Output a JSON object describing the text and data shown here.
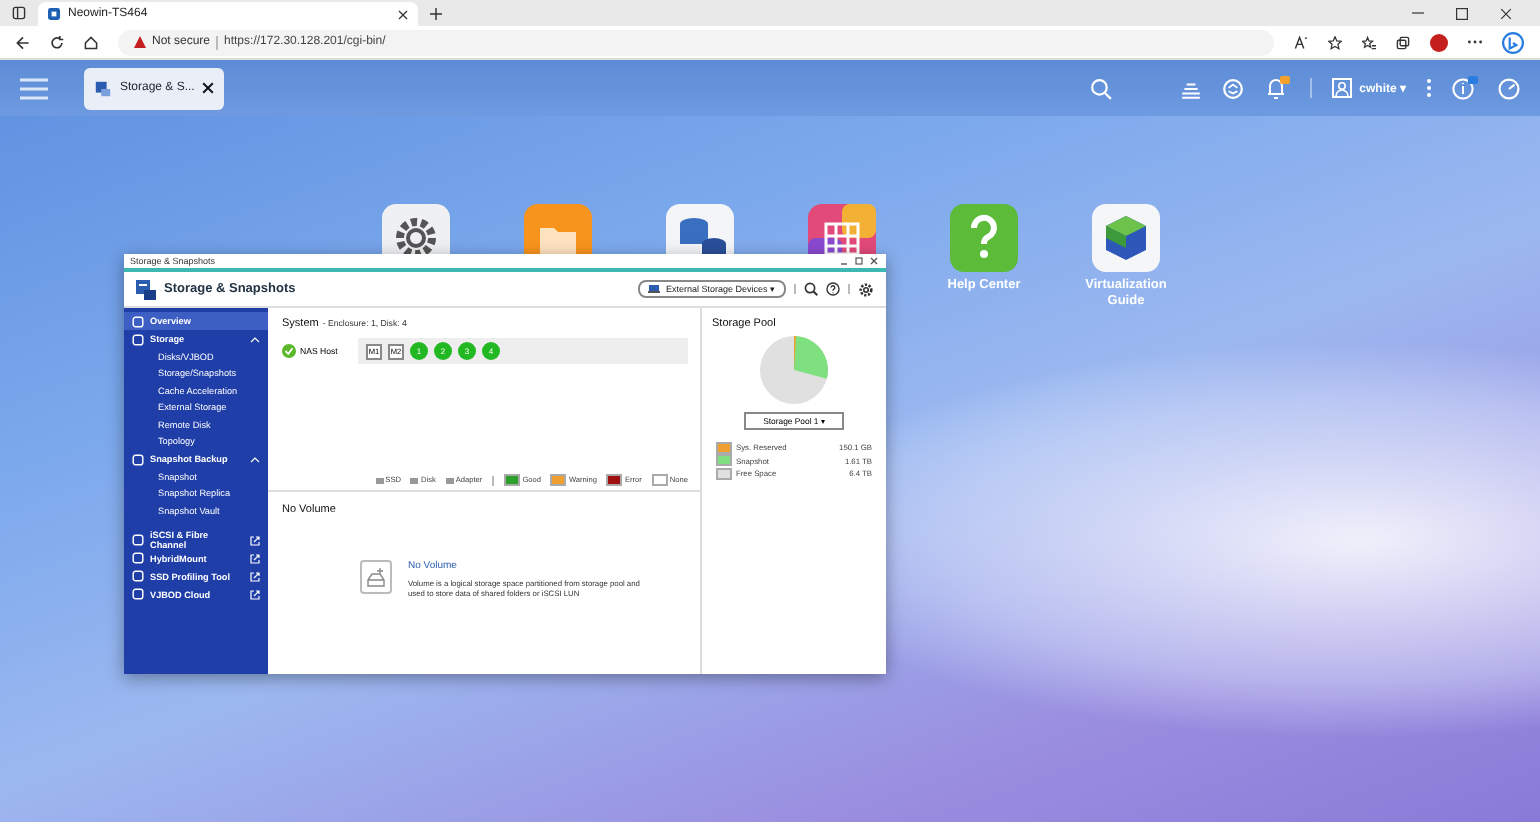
{
  "browser": {
    "tab_title": "Neowin-TS464",
    "security": "Not secure",
    "url": "https://172.30.128.201/cgi-bin/"
  },
  "taskbar": {
    "app_tab": "Storage & S...",
    "user": "cwhite ▾"
  },
  "desktop_icons": [
    {
      "kind": "settings"
    },
    {
      "kind": "folder"
    },
    {
      "kind": "storage"
    },
    {
      "kind": "apps"
    },
    {
      "kind": "help",
      "label": "Help Center"
    },
    {
      "kind": "virtualization",
      "label": "Virtualization Guide"
    }
  ],
  "window": {
    "title": "Storage & Snapshots",
    "header": "Storage & Snapshots",
    "device_menu": "External Storage Devices ▾",
    "sidebar": [
      {
        "kind": "item",
        "label": "Overview",
        "selected": true
      },
      {
        "kind": "group",
        "label": "Storage",
        "selected": false,
        "expanded": true,
        "children": [
          {
            "label": "Disks/VJBOD",
            "selected": false
          },
          {
            "label": "Storage/Snapshots",
            "selected": false
          },
          {
            "label": "Cache Acceleration",
            "selected": false
          },
          {
            "label": "External Storage",
            "selected": false
          },
          {
            "label": "Remote Disk",
            "selected": false
          },
          {
            "label": "Topology",
            "selected": false
          }
        ]
      },
      {
        "kind": "group",
        "label": "Snapshot Backup",
        "selected": false,
        "expanded": true,
        "children": [
          {
            "label": "Snapshot",
            "selected": false
          },
          {
            "label": "Snapshot Replica",
            "selected": false
          },
          {
            "label": "Snapshot Vault",
            "selected": false
          }
        ]
      },
      {
        "kind": "link",
        "label": "iSCSI & Fibre Channel",
        "selected": false
      },
      {
        "kind": "link",
        "label": "HybridMount",
        "selected": false
      },
      {
        "kind": "link",
        "label": "SSD Profiling Tool",
        "selected": false
      },
      {
        "kind": "link",
        "label": "VJBOD Cloud",
        "selected": false
      }
    ],
    "system": {
      "title": "System",
      "subtitle": "- Enclosure: 1, Disk: 4",
      "host": "NAS Host",
      "slots": [
        {
          "kind": "slot",
          "label": "M1"
        },
        {
          "kind": "slot",
          "label": "M2"
        },
        {
          "kind": "disk",
          "label": "1",
          "color": "#22b822"
        },
        {
          "kind": "disk",
          "label": "2",
          "color": "#22b822"
        },
        {
          "kind": "disk",
          "label": "3",
          "color": "#22b822"
        },
        {
          "kind": "disk",
          "label": "4",
          "color": "#22b822"
        }
      ],
      "type_legend": [
        "SSD",
        "Disk",
        "Adapter"
      ],
      "status_legend": [
        {
          "label": "Good",
          "color": "#2aa12a"
        },
        {
          "label": "Warning",
          "color": "#f0a030"
        },
        {
          "label": "Error",
          "color": "#a01010"
        },
        {
          "label": "None",
          "color": "#ffffff"
        }
      ]
    },
    "volume": {
      "title": "No Volume",
      "empty_title": "No Volume",
      "empty_text": "Volume is a logical storage space partitioned from storage pool and used to store data of shared folders or iSCSI LUN"
    },
    "pool": {
      "title": "Storage Pool",
      "selector": "Storage Pool 1 ▾",
      "legend": [
        {
          "label": "Sys. Reserved",
          "value": "150.1 GB",
          "color": "#f0a030"
        },
        {
          "label": "Snapshot",
          "value": "1.61 TB",
          "color": "#7ee07e"
        },
        {
          "label": "Free Space",
          "value": "6.4 TB",
          "color": "#e0e0e0"
        }
      ]
    }
  }
}
